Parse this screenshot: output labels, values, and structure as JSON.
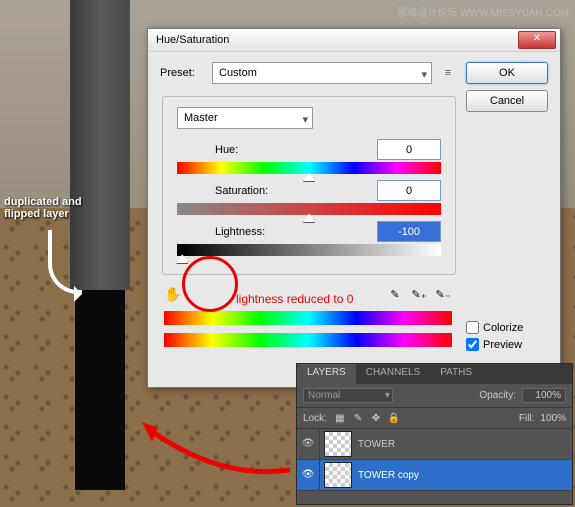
{
  "watermark": "思缘设计论坛  WWW.MISSYUAN.COM",
  "annotation1_l1": "duplicated and",
  "annotation1_l2": "flipped layer",
  "annotation_red": "lightness reduced to 0",
  "dialog": {
    "title": "Hue/Saturation",
    "preset_label": "Preset:",
    "preset_value": "Custom",
    "ok": "OK",
    "cancel": "Cancel",
    "channel": "Master",
    "hue_label": "Hue:",
    "hue_value": "0",
    "sat_label": "Saturation:",
    "sat_value": "0",
    "light_label": "Lightness:",
    "light_value": "-100",
    "colorize": "Colorize",
    "preview": "Preview"
  },
  "layers": {
    "tabs": {
      "layers": "LAYERS",
      "channels": "CHANNELS",
      "paths": "PATHS"
    },
    "blend": "Normal",
    "opacity_label": "Opacity:",
    "opacity": "100%",
    "lock_label": "Lock:",
    "fill_label": "Fill:",
    "fill": "100%",
    "rows": [
      {
        "name": "TOWER"
      },
      {
        "name": "TOWER copy"
      }
    ]
  }
}
